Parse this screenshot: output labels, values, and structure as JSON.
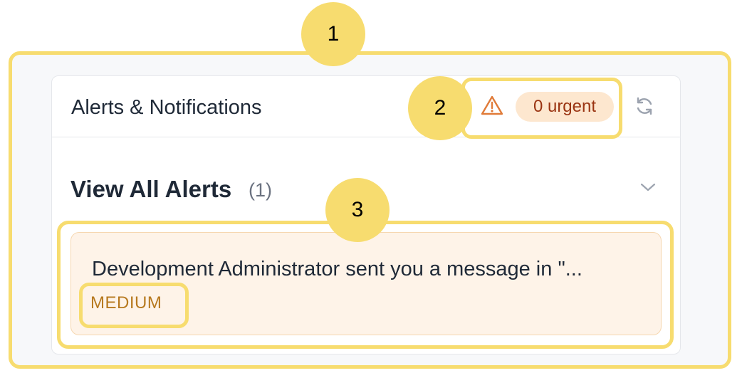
{
  "widget": {
    "title": "Alerts & Notifications",
    "urgent_badge": "0 urgent",
    "section_title": "View All Alerts",
    "section_count": "(1)"
  },
  "alerts": [
    {
      "message": "Development Administrator sent you a message in \"...",
      "priority": "MEDIUM"
    }
  ],
  "markers": [
    "1",
    "2",
    "3"
  ],
  "icons": {
    "warning": "warning-triangle-icon",
    "refresh": "refresh-icon",
    "chevron": "chevron-down-icon"
  },
  "colors": {
    "highlight": "#f7dc6f",
    "urgent_badge_bg": "#fde7cf",
    "urgent_badge_text": "#9a3412",
    "alert_bg": "#fef3e8",
    "priority_text": "#b7791f"
  }
}
